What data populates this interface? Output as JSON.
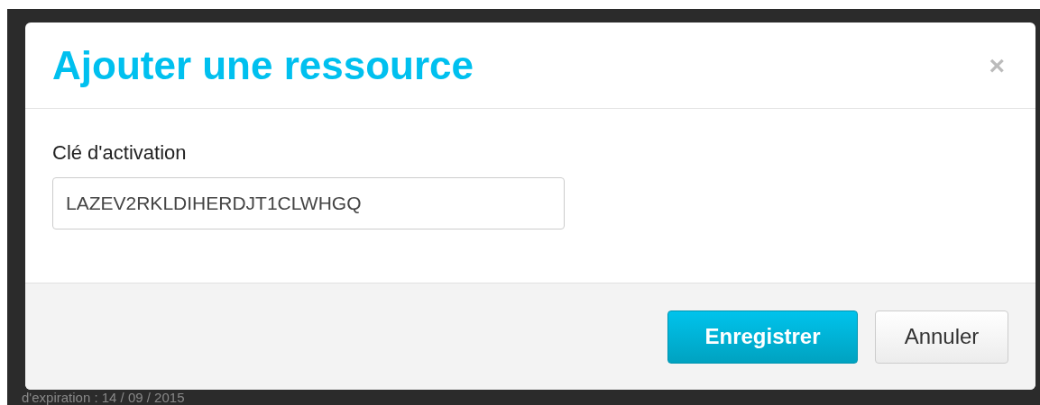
{
  "background": {
    "text": "d'expiration : 14 / 09 / 2015"
  },
  "modal": {
    "title": "Ajouter une ressource",
    "close": "×",
    "field": {
      "label": "Clé d'activation",
      "value": "LAZEV2RKLDIHERDJT1CLWHGQ"
    },
    "buttons": [
      {
        "label": "Enregistrer",
        "kind": "primary"
      },
      {
        "label": "Annuler",
        "kind": "default"
      }
    ]
  }
}
